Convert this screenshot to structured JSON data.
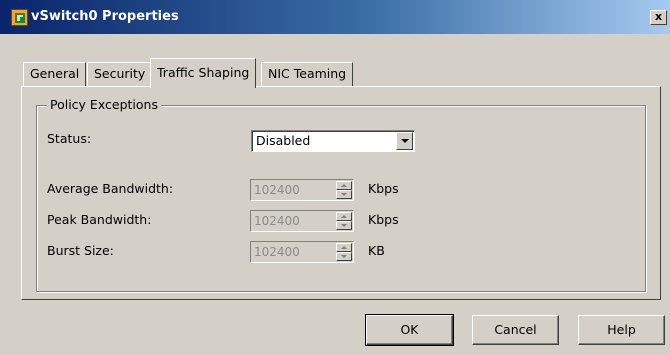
{
  "window": {
    "title": "vSwitch0 Properties",
    "close_glyph": "x",
    "icon": "vmware-switch-icon"
  },
  "tabs": [
    {
      "label": "General",
      "active": false
    },
    {
      "label": "Security",
      "active": false
    },
    {
      "label": "Traffic Shaping",
      "active": true
    },
    {
      "label": "NIC Teaming",
      "active": false
    }
  ],
  "policy": {
    "group_label": "Policy Exceptions",
    "status_label": "Status:",
    "status_value": "Disabled",
    "fields": [
      {
        "label": "Average Bandwidth:",
        "value": "102400",
        "unit": "Kbps"
      },
      {
        "label": "Peak Bandwidth:",
        "value": "102400",
        "unit": "Kbps"
      },
      {
        "label": "Burst Size:",
        "value": "102400",
        "unit": "KB"
      }
    ]
  },
  "buttons": {
    "ok": "OK",
    "cancel": "Cancel",
    "help": "Help"
  },
  "colors": {
    "face": "#d4d0c8",
    "title_start": "#0a246a",
    "title_end": "#a6caf0",
    "disabled_text": "#8a8a8a"
  }
}
